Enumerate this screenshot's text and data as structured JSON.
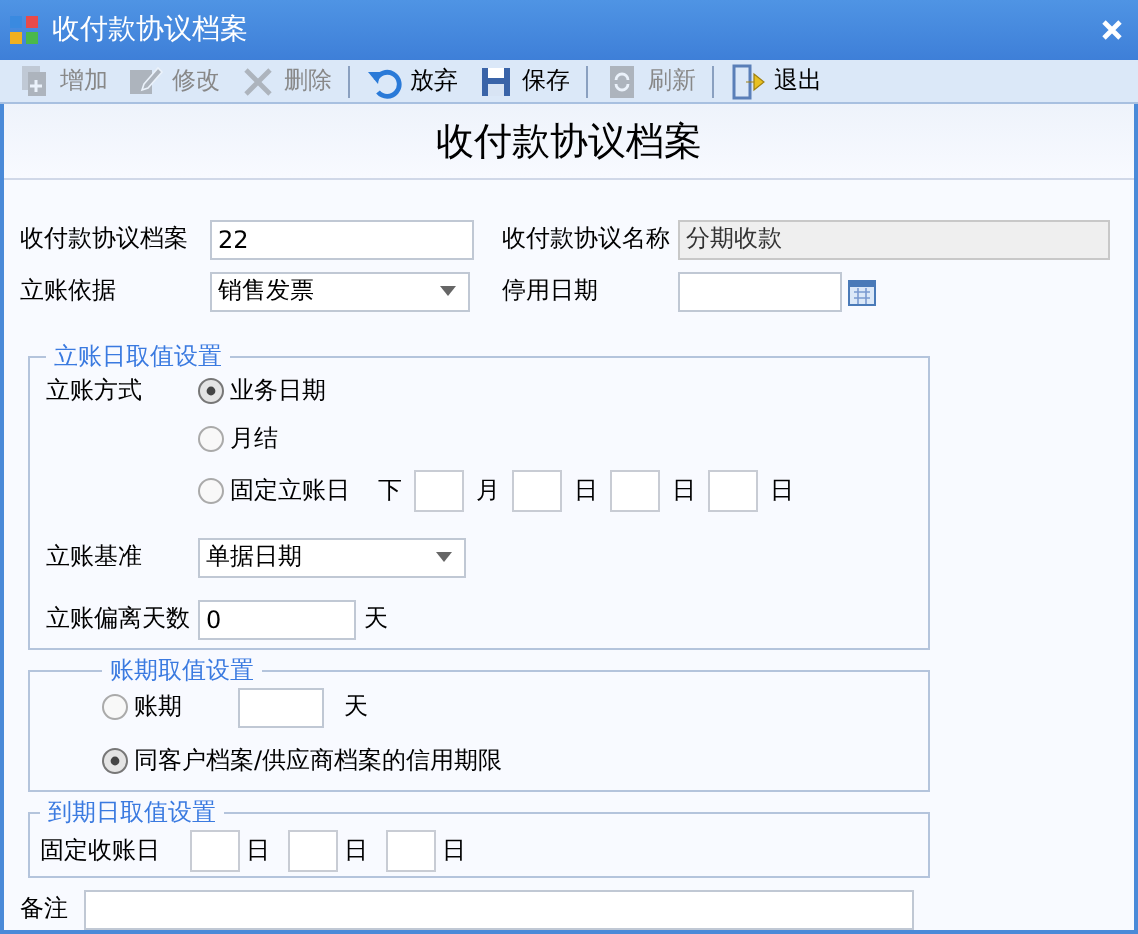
{
  "window": {
    "title": "收付款协议档案"
  },
  "toolbar": [
    {
      "kind": "button",
      "label": "增加",
      "disabled": true
    },
    {
      "kind": "button",
      "label": "修改",
      "disabled": true
    },
    {
      "kind": "button",
      "label": "删除",
      "disabled": true
    },
    {
      "kind": "separator"
    },
    {
      "kind": "button",
      "label": "放弃",
      "disabled": false
    },
    {
      "kind": "button",
      "label": "保存",
      "disabled": false
    },
    {
      "kind": "separator"
    },
    {
      "kind": "button",
      "label": "刷新",
      "disabled": true
    },
    {
      "kind": "separator"
    },
    {
      "kind": "button",
      "label": "退出",
      "disabled": false
    }
  ],
  "form_title": "收付款协议档案",
  "header_fields": [
    {
      "label": "收付款协议档案",
      "kind": "text",
      "value": "22",
      "disabled": false
    },
    {
      "label": "收付款协议名称",
      "kind": "text",
      "value": "分期收款",
      "disabled": true
    },
    {
      "label": "立账依据",
      "kind": "select",
      "value": "销售发票"
    },
    {
      "label": "停用日期",
      "kind": "date"
    }
  ],
  "posting_date": {
    "legend": "立账日取值设置",
    "method_label": "立账方式",
    "options": [
      {
        "label": "业务日期",
        "selected": true
      },
      {
        "label": "月结",
        "selected": false
      },
      {
        "label": "固定立账日",
        "selected": false,
        "prefix": "下",
        "units": [
          "月",
          "日",
          "日",
          "日"
        ]
      }
    ],
    "basis": {
      "label": "立账基准",
      "value": "单据日期"
    },
    "offset": {
      "label": "立账偏离天数",
      "value": "0",
      "unit": "天"
    }
  },
  "term": {
    "legend": "账期取值设置",
    "options": [
      {
        "label": "账期",
        "selected": false,
        "unit": "天"
      },
      {
        "label": "同客户档案/供应商档案的信用期限",
        "selected": true
      }
    ]
  },
  "due_date": {
    "legend": "到期日取值设置",
    "label": "固定收账日",
    "units": [
      "日",
      "日",
      "日"
    ]
  },
  "remark": {
    "label": "备注"
  }
}
